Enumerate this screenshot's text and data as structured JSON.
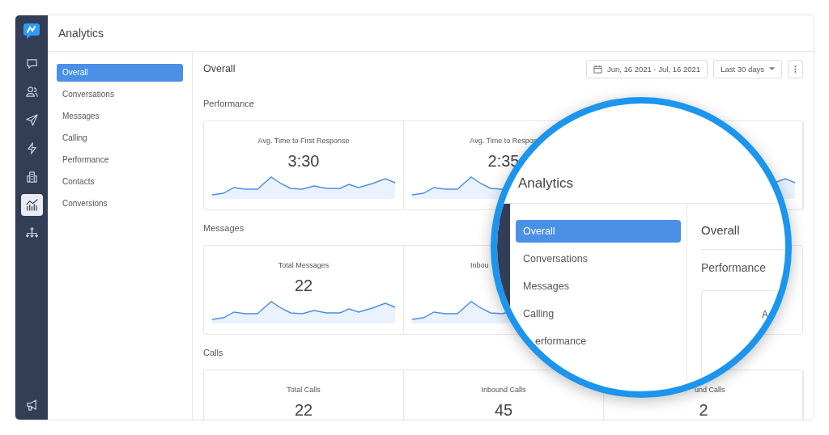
{
  "window": {
    "title": "Analytics"
  },
  "rail": [
    {
      "selected": false
    },
    {
      "selected": false
    },
    {
      "selected": false
    },
    {
      "selected": false
    },
    {
      "selected": false
    },
    {
      "selected": true
    },
    {
      "selected": false
    }
  ],
  "nav": [
    {
      "label": "Overall",
      "selected": true
    },
    {
      "label": "Conversations",
      "selected": false
    },
    {
      "label": "Messages",
      "selected": false
    },
    {
      "label": "Calling",
      "selected": false
    },
    {
      "label": "Performance",
      "selected": false
    },
    {
      "label": "Contacts",
      "selected": false
    },
    {
      "label": "Conversions",
      "selected": false
    }
  ],
  "content": {
    "heading": "Overall",
    "date_range": "Jun, 16 2021 - Jul, 16 2021",
    "period": "Last 30 days",
    "sections": [
      {
        "title": "Performance",
        "cards": [
          {
            "kind": "whole",
            "label": "Avg. Time to First Response",
            "value": "3:30",
            "sparkline": true
          },
          {
            "kind": "whole",
            "label": "Avg. Time to Respon",
            "value": "2:35",
            "sparkline": true
          },
          {
            "sparkline": true
          }
        ]
      },
      {
        "title": "Messages",
        "cards": [
          {
            "kind": "whole",
            "label": "Total Messages",
            "value": "22",
            "sparkline": true
          },
          {
            "kind": "head",
            "label": "Inbou",
            "sparkline": true
          }
        ]
      },
      {
        "title": "Calls",
        "cards": [
          {
            "kind": "whole",
            "label": "Total Calls",
            "value": "22",
            "sparkline": false
          },
          {
            "kind": "whole",
            "label": "Inbound Calls",
            "value": "45",
            "sparkline": false
          },
          {
            "kind": "tail",
            "label": "und Calls",
            "value": "2",
            "sparkline": false
          }
        ]
      }
    ]
  },
  "magnifier": {
    "title": "Analytics",
    "nav": [
      {
        "label": "Overall",
        "selected": true
      },
      {
        "label": "Conversations",
        "selected": false
      },
      {
        "label": "Messages",
        "selected": false
      },
      {
        "label": "Calling",
        "selected": false
      },
      {
        "label": "erformance",
        "selected": false
      }
    ],
    "heading": "Overall",
    "section": "Performance",
    "card_label": "A"
  }
}
